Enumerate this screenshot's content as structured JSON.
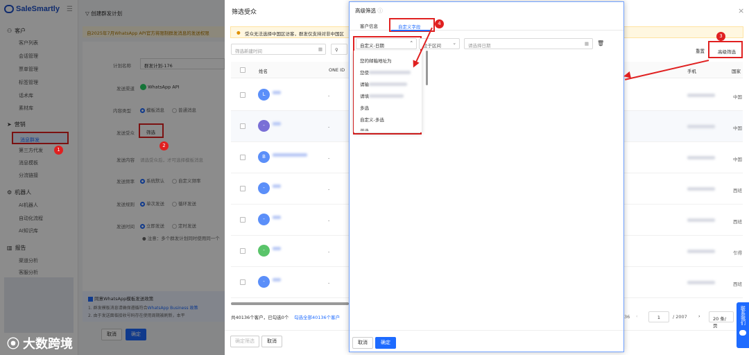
{
  "sidebar": {
    "logo": "SaleSmartly",
    "groups": [
      {
        "label": "客户",
        "items": [
          "客户列表",
          "会话管理",
          "票单管理",
          "标签管理",
          "话术库",
          "素材库"
        ]
      },
      {
        "label": "营销",
        "items": [
          "消息群发",
          "第三方代发",
          "消息模板",
          "分流链接"
        ]
      },
      {
        "label": "机器人",
        "items": [
          "AI机器人",
          "自动化流程",
          "AI知识库"
        ]
      },
      {
        "label": "报告",
        "items": [
          "渠道分析",
          "客服分析"
        ]
      }
    ]
  },
  "main": {
    "breadcrumb": "创建群发计划",
    "notice": "自2025年7月WhatsApp API官方将限制群发消息的发送权限",
    "plan_name_label": "计划名称",
    "plan_name_value": "群发计划-176",
    "channel_label": "发送渠道",
    "channel_value": "WhatsApp API",
    "content_type_label": "内容类型",
    "content_type_options": [
      "模板消息",
      "普通消息"
    ],
    "audience_label": "发送受众",
    "audience_button": "筛选",
    "content_label": "发送内容",
    "content_placeholder": "请选受众后，才可选择模板消息",
    "frequency_label": "发送频率",
    "frequency_options": [
      "系统默认",
      "自定义频率"
    ],
    "rule_label": "发送规则",
    "rule_options": [
      "单次发送",
      "循环发送"
    ],
    "time_label": "发送时间",
    "time_options": [
      "立即发送",
      "定时发送"
    ],
    "time_note": "注意：多个群发计划同时使用同一个",
    "bottom_check": "同意WhatsApp模板发送政策",
    "bottom_note1": "1. 群发模板消息请确保遵循符合",
    "bottom_link": "WhatsApp Business 政策",
    "bottom_note2": "2. 由于发送面临接收号码存在使用周期被刷新，本平",
    "cancel": "取消",
    "confirm": "确定"
  },
  "panel": {
    "title": "筛选受众",
    "warning": "受众无法选择中国区访客，群发仅支持对非中国区",
    "date_placeholder": "筛选新建时间",
    "reset": "重置",
    "advanced": "高级筛选",
    "columns": [
      "姓名",
      "ONE ID",
      "手机",
      "国家"
    ],
    "rows": [
      {
        "avatar": "L",
        "color": "#5b8ff9",
        "country": "中国"
      },
      {
        "avatar": "-",
        "color": "#7a6fd6",
        "country": "中国"
      },
      {
        "avatar": "B",
        "color": "#5b8ff9",
        "country": "中国"
      },
      {
        "avatar": "-",
        "color": "#5b8ff9",
        "country": "西班"
      },
      {
        "avatar": "-",
        "color": "#5b8ff9",
        "country": "西班"
      },
      {
        "avatar": "-",
        "color": "#5ac46a",
        "country": "乍得"
      },
      {
        "avatar": "-",
        "color": "#5b8ff9",
        "country": "西班"
      }
    ],
    "dash": "-",
    "total_text": "共40136个客户，已勾选0个",
    "select_all": "勾选全部40136个客户",
    "page_left": "36",
    "page_current": "1",
    "page_total": "/ 2007",
    "page_size": "20 条/页",
    "bottom_confirm": "确定筛选",
    "bottom_cancel": "取消"
  },
  "modal": {
    "title": "高级筛选",
    "tabs": [
      "客户信息",
      "自定义字段"
    ],
    "field_select": "自定义-日期",
    "range_select": "位于区间",
    "date_placeholder": "请选择日期",
    "options": [
      "您的邮箱地址为",
      "您使",
      "请输",
      "请填",
      "多选",
      "自定义-多选",
      "单选"
    ],
    "cancel": "取消",
    "confirm": "确定"
  },
  "badges": [
    "1",
    "2",
    "3",
    "4"
  ],
  "float_button": "联系我们",
  "watermark": "大数跨境",
  "colors": {
    "accent": "#1e6bff",
    "annotation": "#e02020"
  }
}
